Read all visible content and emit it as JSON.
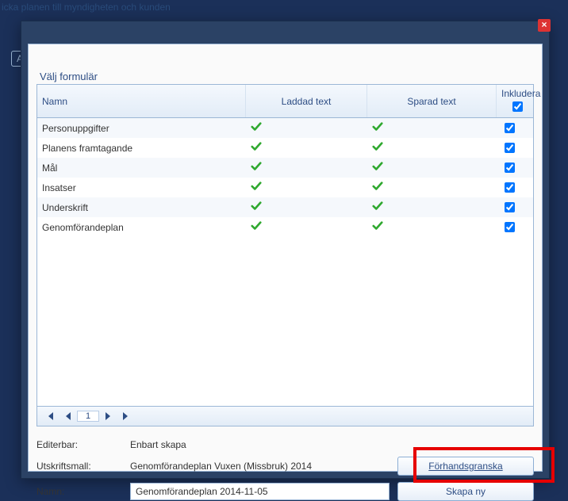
{
  "background": {
    "header_text": "icka planen till myndigheten och kunden",
    "button_label": "Av"
  },
  "dialog": {
    "title": "Välj formulär",
    "close_icon": "×"
  },
  "grid": {
    "headers": {
      "name": "Namn",
      "loaded": "Laddad text",
      "saved": "Sparad text",
      "include": "Inkludera"
    },
    "header_include_checked": true,
    "rows": [
      {
        "name": "Personuppgifter",
        "loaded": true,
        "saved": true,
        "include": true
      },
      {
        "name": "Planens framtagande",
        "loaded": true,
        "saved": true,
        "include": true
      },
      {
        "name": "Mål",
        "loaded": true,
        "saved": true,
        "include": true
      },
      {
        "name": "Insatser",
        "loaded": true,
        "saved": true,
        "include": true
      },
      {
        "name": "Underskrift",
        "loaded": true,
        "saved": true,
        "include": true
      },
      {
        "name": "Genomförandeplan",
        "loaded": true,
        "saved": true,
        "include": true
      }
    ],
    "pager": {
      "page": "1"
    }
  },
  "footer": {
    "editable_label": "Editerbar:",
    "editable_value": "Enbart skapa",
    "template_label": "Utskriftsmall:",
    "template_value": "Genomförandeplan Vuxen (Missbruk) 2014",
    "name_label": "Namn:",
    "name_value": "Genomförandeplan 2014-11-05",
    "preview_button": "Förhandsgranska",
    "create_button": "Skapa ny"
  }
}
